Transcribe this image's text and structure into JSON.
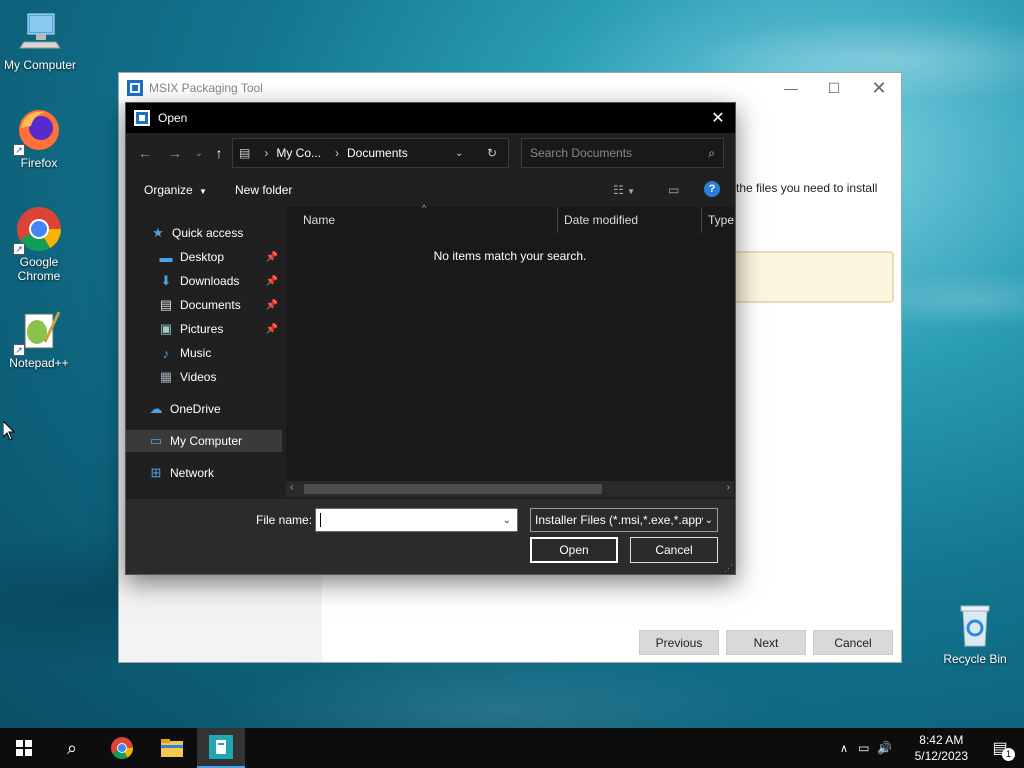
{
  "desktop": {
    "icons": [
      {
        "label": "My Computer",
        "icon": "computer-icon"
      },
      {
        "label": "Firefox",
        "icon": "firefox-icon"
      },
      {
        "label": "Google Chrome",
        "icon": "chrome-icon"
      },
      {
        "label": "Notepad++",
        "icon": "notepadpp-icon"
      },
      {
        "label": "Recycle Bin",
        "icon": "recycle-bin-icon"
      }
    ]
  },
  "msix": {
    "title": "MSIX Packaging Tool",
    "body_text": "the files you need to install",
    "buttons": {
      "previous": "Previous",
      "next": "Next",
      "cancel": "Cancel"
    }
  },
  "dialog": {
    "title": "Open",
    "breadcrumb": [
      "My Co...",
      "Documents"
    ],
    "search_placeholder": "Search Documents",
    "toolbar": {
      "organize": "Organize",
      "new_folder": "New folder"
    },
    "nav": {
      "quick_access": "Quick access",
      "items": [
        {
          "label": "Desktop",
          "pinned": true
        },
        {
          "label": "Downloads",
          "pinned": true
        },
        {
          "label": "Documents",
          "pinned": true
        },
        {
          "label": "Pictures",
          "pinned": true
        },
        {
          "label": "Music",
          "pinned": false
        },
        {
          "label": "Videos",
          "pinned": false
        }
      ],
      "onedrive": "OneDrive",
      "my_computer": "My Computer",
      "network": "Network"
    },
    "columns": {
      "name": "Name",
      "date_modified": "Date modified",
      "type": "Type"
    },
    "empty_message": "No items match your search.",
    "file_name_label": "File name:",
    "file_name_value": "",
    "filter_value": "Installer Files (*.msi,*.exe,*.appv",
    "open_button": "Open",
    "cancel_button": "Cancel"
  },
  "taskbar": {
    "time": "8:42 AM",
    "date": "5/12/2023",
    "notification_count": "1"
  }
}
